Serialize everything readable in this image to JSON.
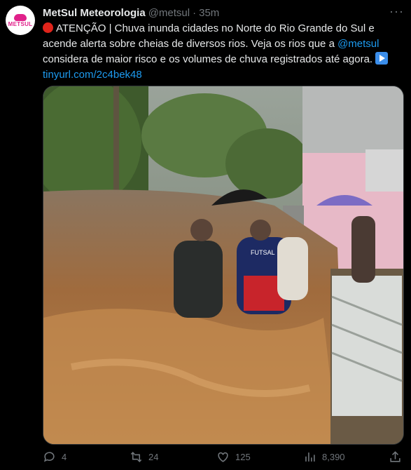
{
  "tweet": {
    "author_name": "MetSul Meteorologia",
    "handle": "@metsul",
    "separator": "·",
    "time": "35m",
    "avatar_text": "METSUL",
    "more_label": "···",
    "text_part1": "ATENÇÃO | Chuva inunda cidades no Norte do Rio Grande do Sul e acende alerta sobre cheias de diversos rios. Veja os rios que a ",
    "mention": "@metsul",
    "text_part2": " considera de maior risco e os volumes de chuva registrados até agora. ",
    "link": "tinyurl.com/2c4bek48",
    "media_jersey_text": "FUTSAL"
  },
  "actions": {
    "replies": "4",
    "retweets": "24",
    "likes": "125",
    "views": "8,390"
  },
  "icons": [
    "alert-red-circle-icon",
    "play-button-icon",
    "reply-icon",
    "retweet-icon",
    "like-icon",
    "views-icon",
    "share-icon",
    "more-icon"
  ],
  "colors": {
    "link": "#1d9bf0",
    "background": "#000000",
    "secondary_text": "#71767b",
    "brand": "#e0218a"
  }
}
